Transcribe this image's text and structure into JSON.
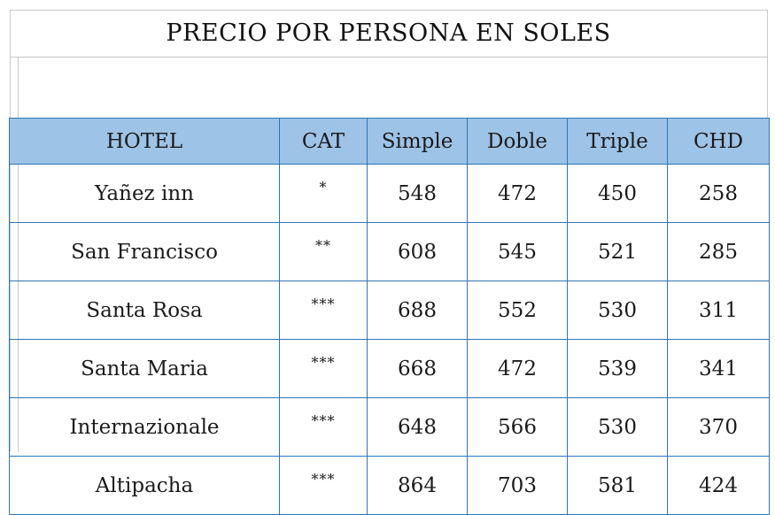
{
  "title": "PRECIO POR PERSONA EN SOLES",
  "table": {
    "headers": {
      "hotel": "HOTEL",
      "cat": "CAT",
      "simple": "Simple",
      "doble": "Doble",
      "triple": "Triple",
      "chd": "CHD"
    },
    "rows": [
      {
        "hotel": "Yañez inn",
        "cat": "*",
        "simple": "548",
        "doble": "472",
        "triple": "450",
        "chd": "258"
      },
      {
        "hotel": "San Francisco",
        "cat": "**",
        "simple": "608",
        "doble": "545",
        "triple": "521",
        "chd": "285"
      },
      {
        "hotel": "Santa Rosa",
        "cat": "***",
        "simple": "688",
        "doble": "552",
        "triple": "530",
        "chd": "311"
      },
      {
        "hotel": "Santa Maria",
        "cat": "***",
        "simple": "668",
        "doble": "472",
        "triple": "539",
        "chd": "341"
      },
      {
        "hotel": "Internazionale",
        "cat": "***",
        "simple": "648",
        "doble": "566",
        "triple": "530",
        "chd": "370"
      },
      {
        "hotel": "Altipacha",
        "cat": "***",
        "simple": "864",
        "doble": "703",
        "triple": "581",
        "chd": "424"
      }
    ]
  },
  "colors": {
    "header_fill": "#9dc3e6",
    "table_border": "#2e75b6",
    "gridline": "#c9c9c9"
  }
}
